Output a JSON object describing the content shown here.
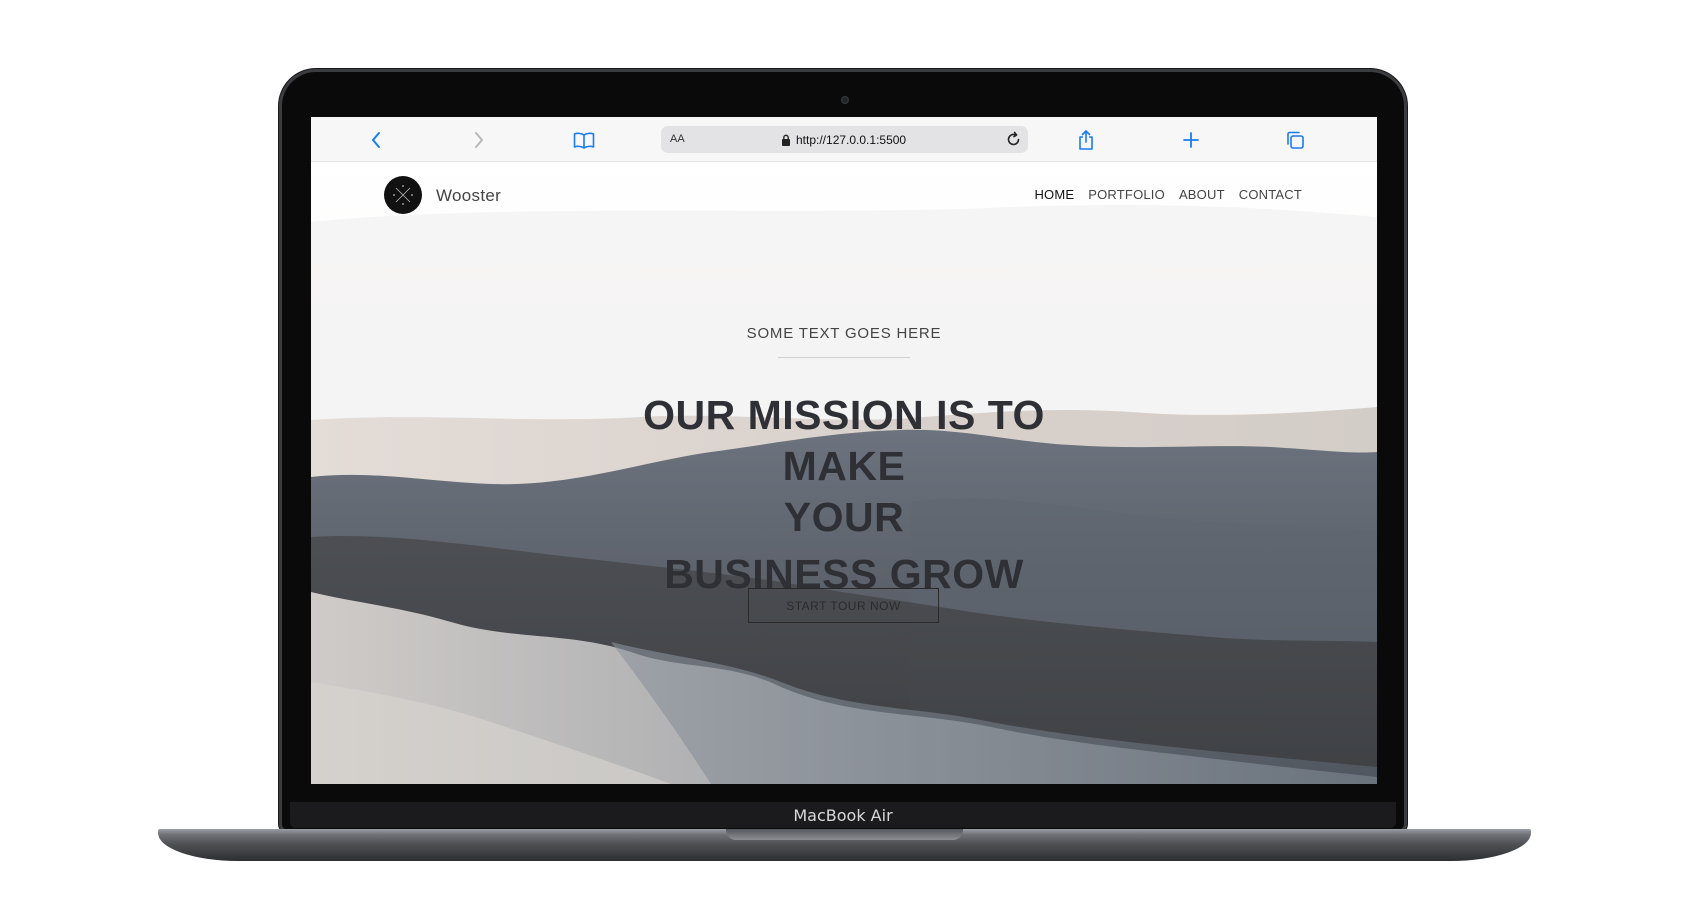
{
  "device": {
    "label": "MacBook Air"
  },
  "browser": {
    "text_size_label": "AA",
    "url": "http://127.0.0.1:5500",
    "icons": {
      "back": "chevron-left-icon",
      "forward": "chevron-right-icon",
      "bookmarks": "book-icon",
      "lock": "lock-icon",
      "reload": "reload-icon",
      "share": "share-icon",
      "new_tab": "plus-icon",
      "tabs": "tabs-icon"
    },
    "accent": "#1a7cf0"
  },
  "site": {
    "brand": "Wooster",
    "nav": [
      {
        "label": "HOME",
        "active": true
      },
      {
        "label": "PORTFOLIO",
        "active": false
      },
      {
        "label": "ABOUT",
        "active": false
      },
      {
        "label": "CONTACT",
        "active": false
      }
    ],
    "hero": {
      "kicker": "SOME TEXT GOES HERE",
      "title_line1": "OUR MISSION IS TO MAKE",
      "title_line2": "YOUR",
      "title_line3": "BUSINESS GROW",
      "cta": "START TOUR NOW"
    }
  }
}
